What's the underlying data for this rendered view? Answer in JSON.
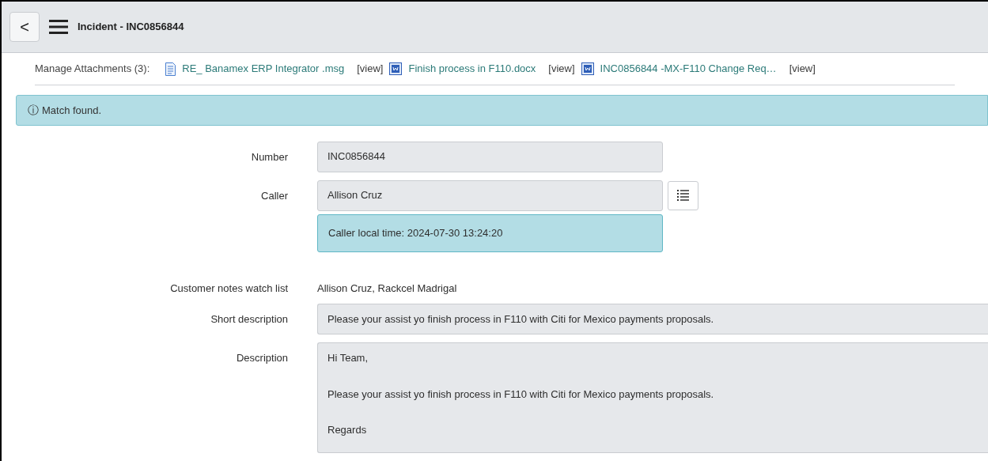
{
  "header": {
    "back": "<",
    "title": "Incident - INC0856844"
  },
  "attachments": {
    "label": "Manage Attachments (3):",
    "files": [
      {
        "name": "RE_ Banamex ERP Integrator .msg",
        "kind": "msg",
        "view": "[view]"
      },
      {
        "name": "Finish process in F110.docx",
        "kind": "doc",
        "view": "[view]"
      },
      {
        "name": "INC0856844 -MX-F110 Change Req…",
        "kind": "doc",
        "view": "[view]"
      }
    ]
  },
  "message": {
    "icon": "ⓘ",
    "text": "Match found."
  },
  "fields": [
    {
      "kind": "input",
      "label": "Number",
      "value": "INC0856844"
    },
    {
      "kind": "lookup",
      "label": "Caller",
      "value": "Allison Cruz",
      "note": "Caller local time: 2024-07-30 13:24:20"
    },
    {
      "kind": "text",
      "label": "Customer notes watch list",
      "value": "Allison Cruz, Rackcel Madrigal"
    },
    {
      "kind": "wide",
      "label": "Short description",
      "value": "Please your assist yo finish process in F110 with Citi for Mexico payments proposals."
    },
    {
      "kind": "textarea",
      "label": "Description",
      "lines": [
        "Hi Team,",
        "Please your assist yo finish process in F110 with Citi for Mexico payments proposals.",
        "Regards"
      ]
    }
  ]
}
